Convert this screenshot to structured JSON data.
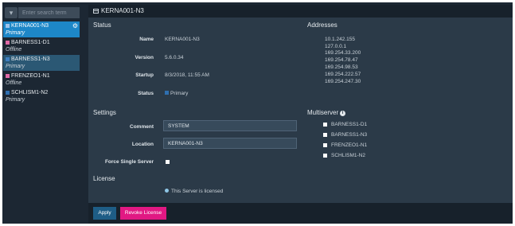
{
  "sidebar": {
    "filter_icon": "filter-icon",
    "search_placeholder": "Enter search term",
    "servers": [
      {
        "name": "KERNA001-N3",
        "status": "Primary",
        "color": "#9fc5ec"
      },
      {
        "name": "BARNESS1-D1",
        "status": "Offline",
        "color": "#e06aa6"
      },
      {
        "name": "BARNESS1-N3",
        "status": "Primary",
        "color": "#3f7fc0"
      },
      {
        "name": "FRENZEO1-N1",
        "status": "Offline",
        "color": "#e06aa6"
      },
      {
        "name": "SCHLISM1-N2",
        "status": "Primary",
        "color": "#2f6fb0"
      }
    ]
  },
  "header": {
    "title": "KERNA001-N3"
  },
  "status": {
    "heading": "Status",
    "name_label": "Name",
    "name": "KERNA001-N3",
    "version_label": "Version",
    "version": "5.6.0.34",
    "startup_label": "Startup",
    "startup": "8/3/2018, 11:55 AM",
    "status_label": "Status",
    "status_value": "Primary"
  },
  "addresses": {
    "heading": "Addresses",
    "list": [
      "10.1.242.155",
      "127.0.0.1",
      "169.254.33.200",
      "169.254.78.47",
      "169.254.98.53",
      "169.254.222.57",
      "169.254.247.30"
    ]
  },
  "settings": {
    "heading": "Settings",
    "comment_label": "Comment",
    "comment": "SYSTEM",
    "location_label": "Location",
    "location": "KERNA001-N3",
    "force_label": "Force Single Server"
  },
  "multiserver": {
    "heading": "Multiserver",
    "servers": [
      "BARNESS1-D1",
      "BARNESS1-N3",
      "FRENZEO1-N1",
      "SCHLISM1-N2"
    ]
  },
  "license": {
    "heading": "License",
    "text": "This Server is licensed"
  },
  "footer": {
    "apply": "Apply",
    "revoke": "Revoke License"
  }
}
